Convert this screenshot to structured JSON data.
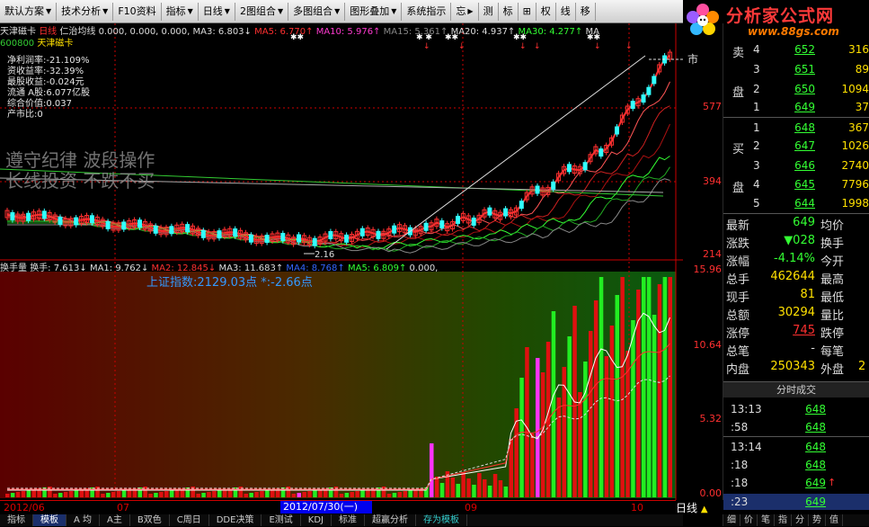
{
  "toolbar": {
    "items": [
      "默认方案",
      "技术分析",
      "F10资料",
      "指标",
      "日线",
      "2图组合",
      "多图组合",
      "图形叠加",
      "系统指示",
      "忘",
      "测",
      "标",
      "权",
      "线",
      "移"
    ],
    "plus": "⊞"
  },
  "logo": {
    "title": "分析家公式网",
    "url": "www.88gs.com"
  },
  "header": {
    "stock": "天津磁卡",
    "period": "日线",
    "indicator": "仁治均线",
    "vals": "0.000, 0.000, 0.000,",
    "ma3": "MA3: 6.803↓",
    "ma5": "MA5: 6.770↑",
    "ma10": "MA10: 5.976↑",
    "ma15": "MA15: 5.361↑",
    "ma20": "MA20: 4.937↑",
    "ma30": "MA30: 4.277↑",
    "ma_last": "MA",
    "code": "600800",
    "name2": "天津磁卡"
  },
  "finance": [
    "净利润率:-21.109%",
    "资收益率:-32.39%",
    "最股收益:-0.024元",
    "流通 A股:6.077亿股",
    "综合价值:0.037",
    "产市比:0"
  ],
  "slogan": [
    "遵守纪律 波段操作",
    "长线投资 不跌不买"
  ],
  "price_axis": [
    "577",
    "394",
    "214"
  ],
  "price_marker": {
    "low": "2.16",
    "high": "市"
  },
  "volume_header": {
    "title": "换手量",
    "hs": "换手: 7.613↓",
    "ma1": "MA1: 9.762↓",
    "ma2": "MA2: 12.845↓",
    "ma3": "MA3: 11.683↑",
    "ma4": "MA4: 8.768↑",
    "ma5": "MA5: 6.809↑",
    "tail": "0.000,"
  },
  "index_note": "上证指数:2129.03点 *:-2.66点",
  "volume_axis": [
    "15.96",
    "10.64",
    "5.32",
    "0.00"
  ],
  "dates": [
    "2012/06",
    "07",
    "09",
    "10"
  ],
  "selected_date": "2012/07/30(一)",
  "period_label": "日线",
  "bottom_tabs": [
    "指标",
    "模板",
    "A 均",
    "A主",
    "B双色",
    "C周日",
    "DDE决策",
    "E测试",
    "KDJ",
    "标准",
    "超赢分析",
    "存为模板"
  ],
  "order_book": {
    "sell_label": [
      "卖",
      "盘"
    ],
    "buy_label": [
      "买",
      "盘"
    ],
    "sell": [
      {
        "n": "4",
        "price": "652",
        "vol": "316"
      },
      {
        "n": "3",
        "price": "651",
        "vol": "89"
      },
      {
        "n": "2",
        "price": "650",
        "vol": "1094"
      },
      {
        "n": "1",
        "price": "649",
        "vol": "37"
      }
    ],
    "buy": [
      {
        "n": "1",
        "price": "648",
        "vol": "367"
      },
      {
        "n": "2",
        "price": "647",
        "vol": "1026"
      },
      {
        "n": "3",
        "price": "646",
        "vol": "2740"
      },
      {
        "n": "4",
        "price": "645",
        "vol": "7796"
      },
      {
        "n": "5",
        "price": "644",
        "vol": "1998"
      }
    ]
  },
  "quotes": [
    {
      "a": "最新",
      "av": "649",
      "b": "均价",
      "bv": ""
    },
    {
      "a": "涨跌",
      "av": "▼028",
      "b": "换手",
      "bv": ""
    },
    {
      "a": "涨幅",
      "av": "-4.14%",
      "b": "今开",
      "bv": ""
    },
    {
      "a": "总手",
      "av": "462644",
      "b": "最高",
      "bv": ""
    },
    {
      "a": "现手",
      "av": "81",
      "b": "最低",
      "bv": ""
    },
    {
      "a": "总额",
      "av": "30294",
      "b": "量比",
      "bv": ""
    },
    {
      "a": "涨停",
      "av": "745",
      "b": "跌停",
      "bv": ""
    },
    {
      "a": "总笔",
      "av": "-",
      "b": "每笔",
      "bv": ""
    },
    {
      "a": "内盘",
      "av": "250343",
      "b": "外盘",
      "bv": "2"
    }
  ],
  "ticks_title": "分时成交",
  "ticks": [
    {
      "t": "13:13",
      "p": "648",
      "u": ""
    },
    {
      "t": ":58",
      "p": "648",
      "u": ""
    },
    {
      "t": "13:14",
      "p": "648",
      "u": ""
    },
    {
      "t": ":18",
      "p": "648",
      "u": ""
    },
    {
      "t": ":18",
      "p": "649",
      "u": "↑"
    },
    {
      "t": ":23",
      "p": "649",
      "u": ""
    }
  ],
  "rp_tabs": [
    "细",
    "价",
    "笔",
    "指",
    "分",
    "势",
    "值"
  ],
  "colors": {
    "up": "#ff3030",
    "down": "#33ff33",
    "bg": "#000000",
    "ma_white": "#ffffff"
  }
}
